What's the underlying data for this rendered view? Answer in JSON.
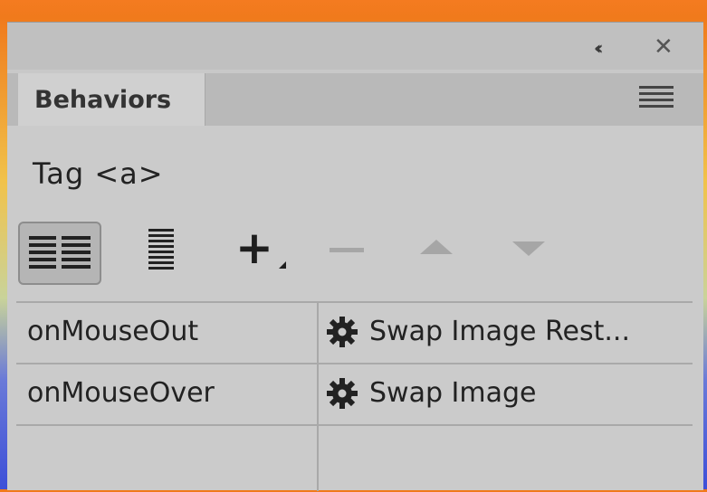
{
  "panel": {
    "tab_label": "Behaviors",
    "tag_label": "Tag <a>"
  },
  "icons": {
    "collapse": "double-chevron-left-icon",
    "close": "close-icon",
    "menu": "panel-menu-icon",
    "show_set": "show-set-events-icon",
    "show_all": "show-all-events-icon",
    "add": "add-behavior-icon",
    "remove": "remove-behavior-icon",
    "up": "move-up-icon",
    "down": "move-down-icon",
    "gear": "gear-icon"
  },
  "colors": {
    "window_frame_top": "#f07a1c",
    "panel_bg": "#cbcbcb",
    "text": "#222222",
    "disabled": "#a6a6a6"
  },
  "behaviors": [
    {
      "event": "onMouseOut",
      "action": "Swap Image Rest..."
    },
    {
      "event": "onMouseOver",
      "action": "Swap Image"
    }
  ]
}
